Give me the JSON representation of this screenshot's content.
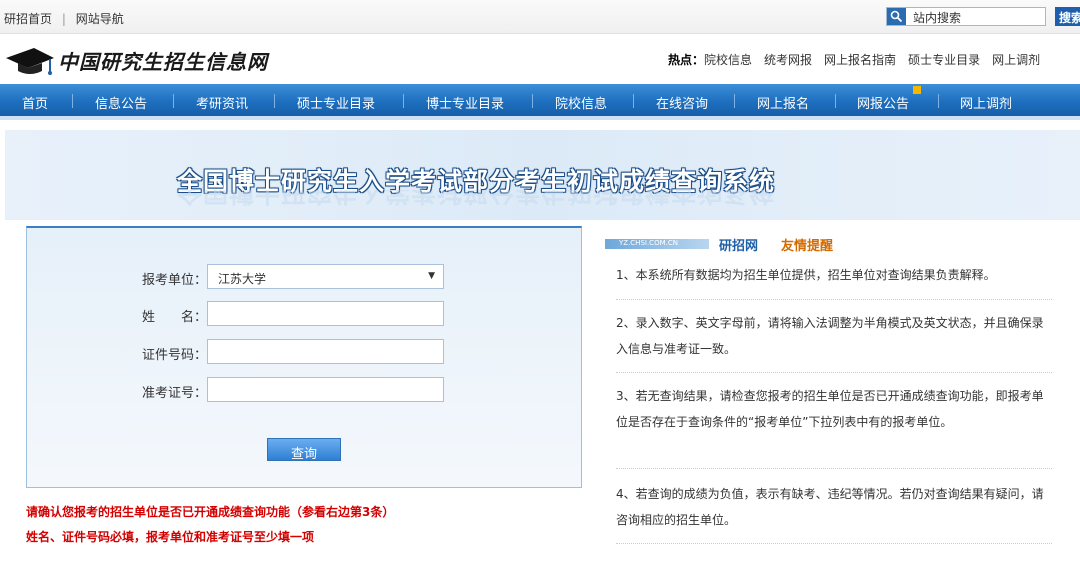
{
  "topbar": {
    "link_home": "研招首页",
    "separator": "|",
    "link_nav": "网站导航",
    "search_placeholder": "站内搜索",
    "search_button": "搜索"
  },
  "header": {
    "logo_text": "中国研究生招生信息网",
    "hot_label": "热点：",
    "hot_links": [
      "院校信息",
      "统考网报",
      "网上报名指南",
      "硕士专业目录",
      "网上调剂"
    ]
  },
  "nav": {
    "items": [
      "首页",
      "信息公告",
      "考研资讯",
      "硕士专业目录",
      "博士专业目录",
      "院校信息",
      "在线咨询",
      "网上报名",
      "网报公告",
      "网上调剂"
    ]
  },
  "banner": {
    "title": "全国博士研究生入学考试部分考生初试成绩查询系统"
  },
  "form": {
    "unit_label": "报考单位：",
    "unit_value": "江苏大学",
    "name_label": "姓　　名：",
    "name_value": "",
    "id_label": "证件号码：",
    "id_value": "",
    "exam_label": "准考证号：",
    "exam_value": "",
    "query_button": "查询"
  },
  "warnings": [
    "请确认您报考的招生单位是否已开通成绩查询功能（参看右边第3条）",
    "姓名、证件号码必填，报考单位和准考证号至少填一项"
  ],
  "tips": {
    "bar_text": "YZ.CHSI.COM.CN",
    "title_part1": "研招网",
    "title_part2": "友情提醒",
    "items": [
      "1、本系统所有数据均为招生单位提供，招生单位对查询结果负责解释。",
      "2、录入数字、英文字母前，请将输入法调整为半角模式及英文状态，并且确保录入信息与准考证一致。",
      "3、若无查询结果，请检查您报考的招生单位是否已开通成绩查询功能，即报考单位是否存在于查询条件的“报考单位”下拉列表中有的报考单位。",
      "4、若查询的成绩为负值，表示有缺考、违纪等情况。若仍对查询结果有疑问，请咨询相应的招生单位。"
    ]
  },
  "colors": {
    "nav_blue": "#1e6fbf",
    "warning_red": "#d40000",
    "tip_orange": "#d46b00"
  }
}
